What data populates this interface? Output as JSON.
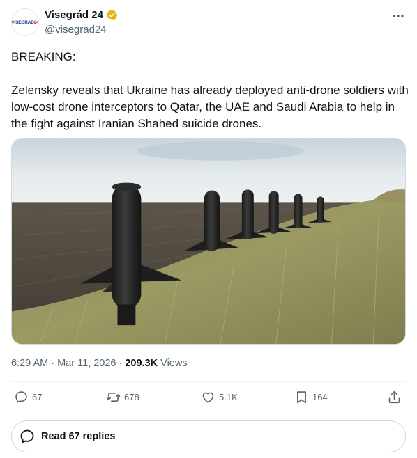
{
  "author": {
    "display_name": "Visegrád 24",
    "handle": "@visegrad24",
    "avatar_text_main": "VISEGRAD",
    "avatar_text_accent": "24",
    "verified_color": "#e2b719"
  },
  "tweet": {
    "line1": "BREAKING:",
    "line2": "Zelensky reveals that Ukraine has already deployed anti-drone soldiers with low-cost drone interceptors to Qatar, the UAE and Saudi Arabia to help in the fight against Iranian Shahed suicide drones."
  },
  "meta": {
    "time": "6:29 AM",
    "date": "Mar 11, 2026",
    "separator": " · ",
    "views_count": "209.3K",
    "views_label": " Views"
  },
  "actions": {
    "replies": "67",
    "reposts": "678",
    "likes": "5.1K",
    "bookmarks": "164"
  },
  "read_replies_label": "Read 67 replies",
  "icons": {
    "verified": "verified-badge-icon",
    "more": "more-dots-icon",
    "reply": "reply-icon",
    "repost": "repost-icon",
    "like": "heart-icon",
    "bookmark": "bookmark-icon",
    "share": "share-icon"
  }
}
